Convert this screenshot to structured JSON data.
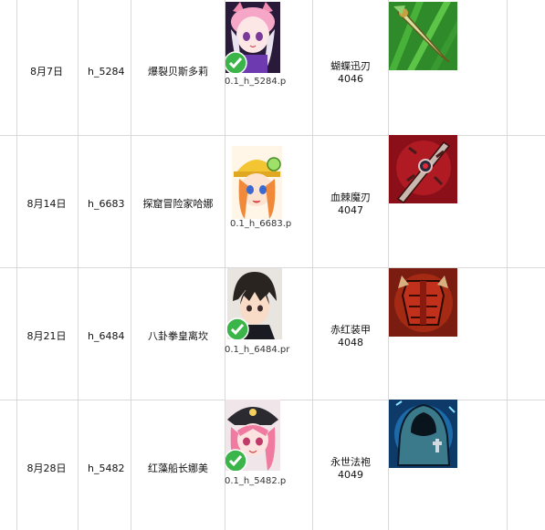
{
  "rows": [
    {
      "date": "8月7日",
      "code": "h_5284",
      "hero": "爆裂贝斯多莉",
      "file": "0.1_h_5284.p",
      "weapon": "蝴蝶迅刃",
      "weapon_id": "4046",
      "hero_icon": "pink-cat-girl-portrait",
      "item_icon": "green-dagger-icon",
      "checked": true
    },
    {
      "date": "8月14日",
      "code": "h_6683",
      "hero": "探窟冒险家哈娜",
      "file": "0.1_h_6683.p",
      "weapon": "血棘魔刃",
      "weapon_id": "4047",
      "hero_icon": "helmet-explorer-girl-portrait",
      "item_icon": "red-thorn-blade-icon",
      "checked": false
    },
    {
      "date": "8月21日",
      "code": "h_6484",
      "hero": "八卦拳皇离坎",
      "file": "0.1_h_6484.pr",
      "weapon": "赤红装甲",
      "weapon_id": "4048",
      "hero_icon": "dark-hair-boy-portrait",
      "item_icon": "red-armor-icon",
      "checked": true
    },
    {
      "date": "8月28日",
      "code": "h_5482",
      "hero": "红藻船长娜美",
      "file": "0.1_h_5482.p",
      "weapon": "永世法袍",
      "weapon_id": "4049",
      "hero_icon": "pirate-captain-girl-portrait",
      "item_icon": "hooded-robe-icon",
      "checked": true
    }
  ],
  "colors": {
    "grid": "#d9d9d9",
    "check_green": "#3bb54a"
  }
}
